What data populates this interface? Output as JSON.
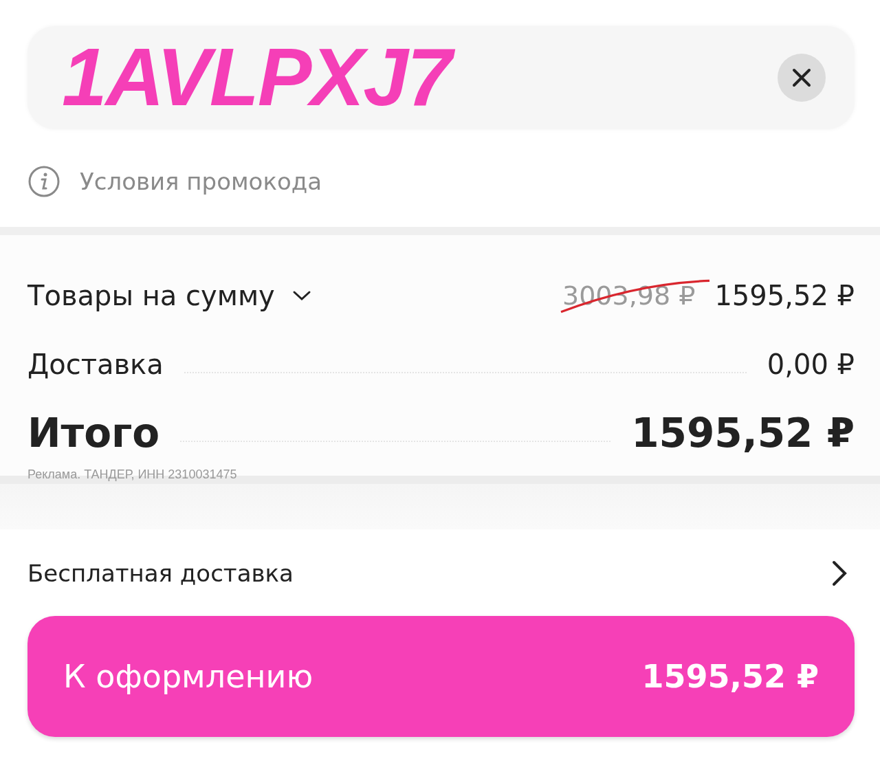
{
  "promo": {
    "value": "1AVLPXJ7"
  },
  "promo_terms": {
    "label": "Условия промокода"
  },
  "summary": {
    "items": {
      "label": "Товары на сумму",
      "expanded": false,
      "old_price": "3003,98 ₽",
      "old_price_struck": true,
      "price": "1595,52 ₽"
    },
    "delivery": {
      "label": "Доставка",
      "price": "0,00 ₽"
    },
    "total": {
      "label": "Итого",
      "price": "1595,52 ₽"
    },
    "ad_note": "Реклама. ТАНДЕР, ИНН 2310031475"
  },
  "free_delivery": {
    "label": "Бесплатная доставка"
  },
  "checkout_button": {
    "label": "К оформлению",
    "price": "1595,52 ₽"
  }
}
